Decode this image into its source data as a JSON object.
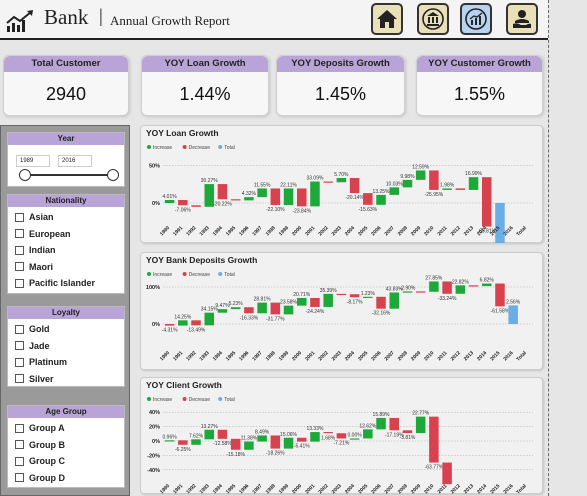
{
  "header": {
    "brand": "Bank",
    "separator": "|",
    "subtitle": "Annual Growth Report",
    "nav": [
      {
        "name": "home-icon"
      },
      {
        "name": "bank-icon"
      },
      {
        "name": "growth-icon"
      },
      {
        "name": "customer-care-icon"
      }
    ],
    "active_nav": 2
  },
  "kpis": [
    {
      "label": "Total Customer",
      "value": "2940"
    },
    {
      "label": "YOY Loan Growth",
      "value": "1.44%"
    },
    {
      "label": "YOY Deposits Growth",
      "value": "1.45%"
    },
    {
      "label": "YOY Customer Growth",
      "value": "1.55%"
    }
  ],
  "filters": {
    "year": {
      "title": "Year",
      "from": "1989",
      "to": "2016"
    },
    "nationality": {
      "title": "Nationality",
      "items": [
        "Asian",
        "European",
        "Indian",
        "Maori",
        "Pacific Islander"
      ]
    },
    "loyalty": {
      "title": "Loyalty",
      "items": [
        "Gold",
        "Jade",
        "Platinum",
        "Silver"
      ]
    },
    "age": {
      "title": "Age Group",
      "items": [
        "Group A",
        "Group B",
        "Group C",
        "Group D"
      ]
    }
  },
  "colors": {
    "increase": "#1fa83a",
    "decrease": "#d8424f",
    "total": "#6aaee8",
    "accent": "#b8a4d6"
  },
  "chart_data": [
    {
      "type": "waterfall",
      "title": "YOY Loan Growth",
      "legend": [
        "Increase",
        "Decrease",
        "Total"
      ],
      "categories": [
        "1990",
        "1991",
        "1992",
        "1993",
        "1994",
        "1995",
        "1996",
        "1997",
        "1998",
        "1999",
        "2000",
        "2001",
        "2002",
        "2003",
        "2004",
        "2005",
        "2006",
        "2007",
        "2008",
        "2009",
        "2010",
        "2011",
        "2012",
        "2013",
        "2014",
        "2015",
        "2016",
        "Total"
      ],
      "values": [
        4.01,
        -7.06,
        -2.0,
        30.27,
        -20.22,
        -1.5,
        4.32,
        11.55,
        -22.1,
        22.11,
        -23.84,
        33.09,
        -1.0,
        5.7,
        -20.14,
        -15.63,
        13.25,
        10.03,
        9.98,
        12.59,
        -25.95,
        1.98,
        -2.0,
        16.99,
        -65.81,
        -22.0
      ],
      "labels": [
        "4.01%",
        "-7.06%",
        "",
        "30.27%",
        "-20.22%",
        "",
        "4.32%",
        "11.55%",
        "-22.10%",
        "22.11%",
        "-23.84%",
        "33.09%",
        "",
        "5.70%",
        "-20.14%",
        "-15.63%",
        "13.25%",
        "10.03%",
        "9.98%",
        "12.59%",
        "-25.95%",
        "1.98%",
        "",
        "16.99%",
        "-65.81%",
        "-4.1%"
      ],
      "yticks": [
        "50%",
        "0%"
      ],
      "total_label": "-4.1%"
    },
    {
      "type": "waterfall",
      "title": "YOY Bank Deposits Growth",
      "legend": [
        "Increase",
        "Decrease",
        "Total"
      ],
      "categories": [
        "1990",
        "1991",
        "1992",
        "1993",
        "1994",
        "1995",
        "1996",
        "1997",
        "1998",
        "1999",
        "2000",
        "2001",
        "2002",
        "2003",
        "2004",
        "2005",
        "2006",
        "2007",
        "2008",
        "2009",
        "2010",
        "2011",
        "2012",
        "2013",
        "2014",
        "2015",
        "2016",
        "Total"
      ],
      "values": [
        -4.31,
        14.25,
        -13.49,
        34.15,
        9.47,
        5.23,
        -16.33,
        28.81,
        -31.77,
        23.58,
        20.71,
        -24.24,
        35.39,
        -1.0,
        -8.17,
        1.23,
        -32.16,
        43.83,
        2.9,
        -1.0,
        27.85,
        -33.24,
        22.82,
        -2.0,
        6.82,
        -61.58,
        2.56
      ],
      "labels": [
        "-4.31%",
        "14.25%",
        "-13.49%",
        "34.15%",
        "9.47%",
        "5.23%",
        "-16.33%",
        "28.81%",
        "-31.77%",
        "23.58%",
        "20.71%",
        "-24.24%",
        "35.39%",
        "",
        "-8.17%",
        "1.23%",
        "-32.16%",
        "43.83%",
        "-2.90%",
        "",
        "27.85%",
        "-33.24%",
        "22.82%",
        "",
        "6.82%",
        "-61.58%",
        "2.56%"
      ],
      "yticks": [
        "100%",
        "0%"
      ],
      "total_label": "2.56%"
    },
    {
      "type": "waterfall",
      "title": "YOY Client Growth",
      "legend": [
        "Increase",
        "Decrease",
        "Total"
      ],
      "categories": [
        "1990",
        "1991",
        "1992",
        "1993",
        "1994",
        "1995",
        "1996",
        "1997",
        "1998",
        "1999",
        "2000",
        "2001",
        "2002",
        "2003",
        "2004",
        "2005",
        "2006",
        "2007",
        "2008",
        "2009",
        "2010",
        "2011",
        "2012",
        "2013",
        "2014",
        "2015",
        "2016",
        "Total"
      ],
      "values": [
        0.96,
        -6.25,
        7.62,
        13.27,
        -12.58,
        -15.18,
        11.38,
        8.49,
        -18.26,
        15.06,
        -5.41,
        13.33,
        -1.68,
        -7.21,
        0.0,
        12.62,
        15.89,
        -17.19,
        -3.81,
        22.77,
        -63.77,
        -30.0
      ],
      "labels": [
        "0.96%",
        "-6.25%",
        "7.62%",
        "13.27%",
        "-12.58%",
        "-15.18%",
        "11.38%",
        "8.49%",
        "-18.26%",
        "15.06%",
        "-5.41%",
        "13.33%",
        "1.68%",
        "-7.21%",
        "0.00%",
        "12.62%",
        "15.89%",
        "-17.19%",
        "-3.81%",
        "22.77%",
        "-63.77%",
        ""
      ],
      "yticks": [
        "40%",
        "20%",
        "0%",
        "-20%",
        "-40%"
      ],
      "total_label": ""
    }
  ]
}
